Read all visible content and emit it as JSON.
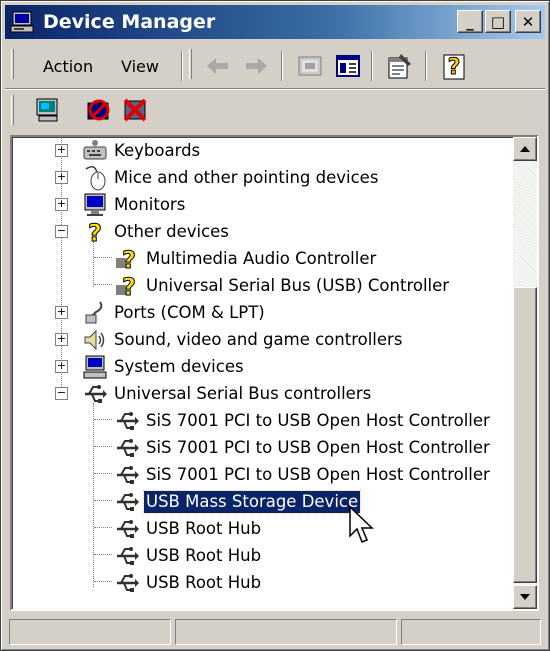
{
  "window": {
    "title": "Device Manager",
    "controls": {
      "minimize": "_",
      "maximize": "□",
      "close": "✕"
    }
  },
  "menu": {
    "action": "Action",
    "view": "View"
  },
  "tree": [
    {
      "label": "Keyboards",
      "icon": "keyboard-icon",
      "expander": "+"
    },
    {
      "label": "Mice and other pointing devices",
      "icon": "mouse-icon",
      "expander": "+"
    },
    {
      "label": "Monitors",
      "icon": "monitor-icon",
      "expander": "+"
    },
    {
      "label": "Other devices",
      "icon": "question-device-icon",
      "expander": "−"
    },
    {
      "label": "Multimedia Audio Controller",
      "icon": "question-device-icon"
    },
    {
      "label": "Universal Serial Bus (USB) Controller",
      "icon": "question-device-icon"
    },
    {
      "label": "Ports (COM & LPT)",
      "icon": "port-icon",
      "expander": "+"
    },
    {
      "label": "Sound, video and game controllers",
      "icon": "speaker-icon",
      "expander": "+"
    },
    {
      "label": "System devices",
      "icon": "computer-icon",
      "expander": "+"
    },
    {
      "label": "Universal Serial Bus controllers",
      "icon": "usb-icon",
      "expander": "−"
    },
    {
      "label": "SiS 7001 PCI to USB Open Host Controller",
      "icon": "usb-icon"
    },
    {
      "label": "SiS 7001 PCI to USB Open Host Controller",
      "icon": "usb-icon"
    },
    {
      "label": "SiS 7001 PCI to USB Open Host Controller",
      "icon": "usb-icon"
    },
    {
      "label": "USB Mass Storage Device",
      "icon": "usb-icon",
      "selected": true
    },
    {
      "label": "USB Root Hub",
      "icon": "usb-icon"
    },
    {
      "label": "USB Root Hub",
      "icon": "usb-icon"
    },
    {
      "label": "USB Root Hub",
      "icon": "usb-icon"
    }
  ],
  "colors": {
    "title_start": "#0a246a",
    "title_end": "#a6caf0",
    "selection": "#0a246a",
    "chrome": "#d4d0c8"
  }
}
